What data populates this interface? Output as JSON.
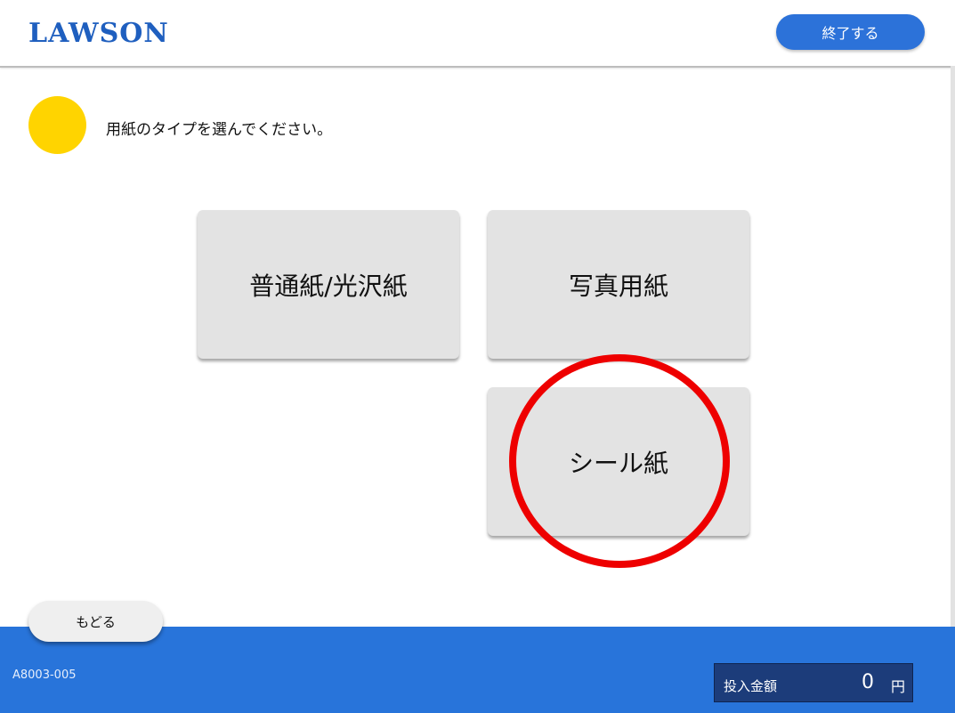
{
  "header": {
    "logo_text": "LAWSON",
    "end_button_label": "終了する"
  },
  "prompt": {
    "text": "用紙のタイプを選んでください。"
  },
  "choices": [
    {
      "label": "普通紙/光沢紙"
    },
    {
      "label": "写真用紙"
    },
    {
      "label": "シール紙",
      "highlighted": true
    }
  ],
  "footer": {
    "back_button_label": "もどる",
    "screen_code": "A8003-005",
    "amount_label": "投入金額",
    "amount_value": "0",
    "amount_unit": "円"
  },
  "colors": {
    "brand_blue": "#2874da",
    "logo_blue": "#1f5fbf",
    "prompt_dot": "#ffd400",
    "highlight_ring": "#ee0000",
    "button_gray": "#e3e3e3"
  }
}
